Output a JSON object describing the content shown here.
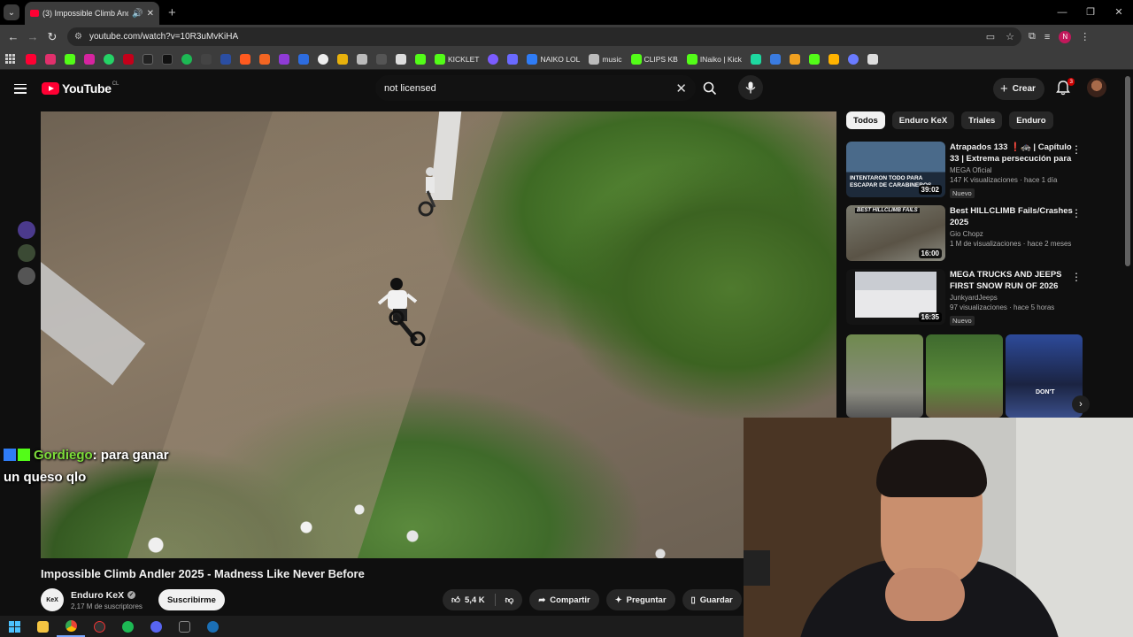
{
  "browser": {
    "tab_title": "(3) Impossible Climb Andler 2025 - Madness Like Never Before",
    "url": "youtube.com/watch?v=10R3uMvKiHA",
    "profile_initial": "N",
    "bookmarks": [
      {
        "label": "KICKLET",
        "color": "#53fc18"
      },
      {
        "label": "NAIKO LOL",
        "color": "#2f7cf6"
      },
      {
        "label": "music",
        "color": "#bbbbbb"
      },
      {
        "label": "CLIPS KB",
        "color": "#53fc18"
      },
      {
        "label": "INaiko | Kick",
        "color": "#53fc18"
      }
    ]
  },
  "youtube": {
    "logo_text": "YouTube",
    "region": "CL",
    "search_value": "not licensed",
    "create_label": "Crear",
    "notifications_count": "3"
  },
  "video": {
    "title": "Impossible Climb Andler 2025 - Madness Like Never Before",
    "channel_name": "Enduro KeX",
    "channel_logo_text": "KeX",
    "subscribers": "2,17 M de suscriptores",
    "subscribe_label": "Suscribirme",
    "likes": "5,4 K",
    "share_label": "Compartir",
    "ask_label": "Preguntar",
    "save_label": "Guardar"
  },
  "chat_overlay": {
    "username": "Gordiego",
    "message_line1": ": para ganar",
    "message_line2": "un queso qlo"
  },
  "chips": [
    "Todos",
    "Enduro KeX",
    "Triales",
    "Enduro"
  ],
  "recommendations": [
    {
      "title": "Atrapados 133 ❗🚓 | Capítulo 33 | Extrema persecución para ...",
      "channel": "MEGA Oficial",
      "stats": "147 K visualizaciones · hace 1 día",
      "duration": "39:02",
      "badge": "Nuevo",
      "thumb_text": "INTENTARON TODO PARA ESCAPAR DE CARABINEROS"
    },
    {
      "title": "Best HILLCLIMB Fails/Crashes 2025",
      "channel": "Gio Chopz",
      "stats": "1 M de visualizaciones · hace 2 meses",
      "duration": "16:00",
      "badge": "",
      "thumb_text": "BEST HILLCLIMB FAILS"
    },
    {
      "title": "MEGA TRUCKS AND JEEPS FIRST SNOW RUN OF 2026",
      "channel": "JunkyardJeeps",
      "stats": "97 visualizaciones · hace 5 horas",
      "duration": "16:35",
      "badge": "Nuevo",
      "thumb_text": ""
    }
  ],
  "short_caption": "DON'T",
  "colors": {
    "yt_red": "#ff0033",
    "background": "#0f0f0f",
    "chat_name": "#7ddc3a"
  }
}
